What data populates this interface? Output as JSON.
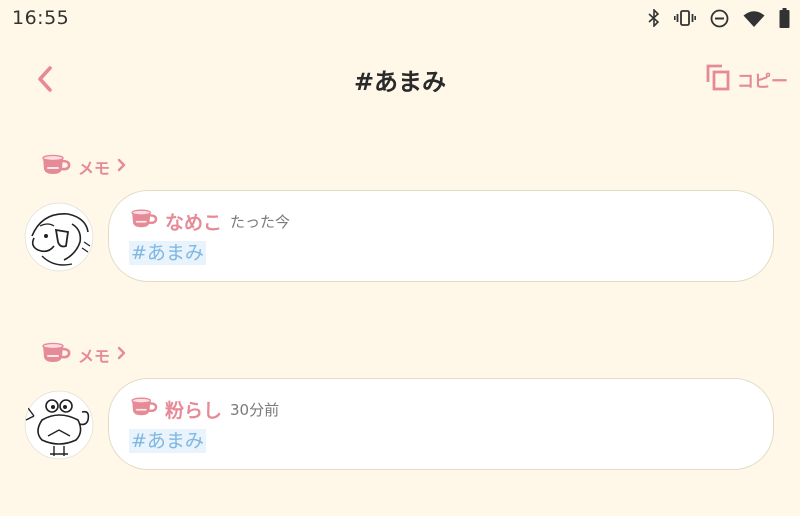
{
  "status_bar": {
    "time": "16:55",
    "icons": [
      "bluetooth-icon",
      "vibrate-icon",
      "do-not-disturb-icon",
      "wifi-icon",
      "battery-icon"
    ]
  },
  "header": {
    "title": "#あまみ",
    "back_icon": "chevron-left-icon",
    "copy_label": "コピー",
    "copy_icon": "copy-icon"
  },
  "notes": [
    {
      "channel_label": "メモ",
      "user_name": "なめこ",
      "time": "たった今",
      "text": "#あまみ"
    },
    {
      "channel_label": "メモ",
      "user_name": "粉らし",
      "time": "30分前",
      "text": "#あまみ"
    }
  ],
  "colors": {
    "background": "#FFF8E9",
    "accent": "#E58A96",
    "hashtag": "#7FB7E3",
    "hashtag_bg": "#E8F3FB",
    "bubble_border": "#E2DCC6"
  }
}
